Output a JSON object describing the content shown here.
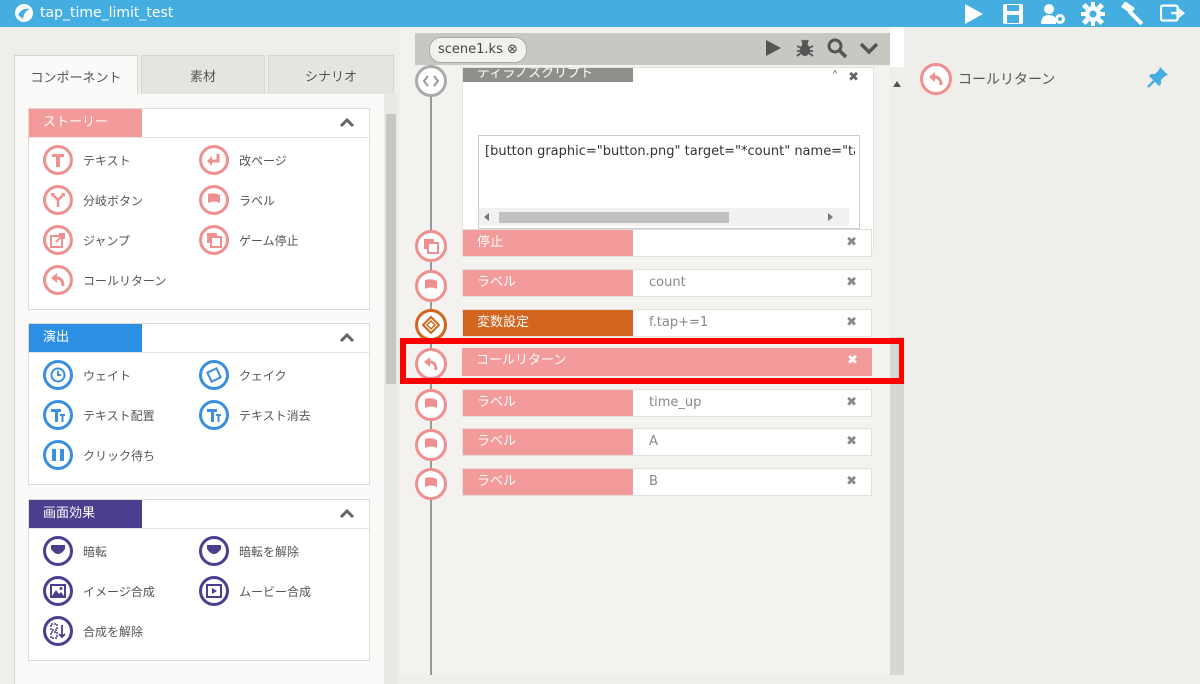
{
  "app": {
    "title": "tap_time_limit_test"
  },
  "left_tabs": [
    {
      "label": "コンポーネント",
      "active": true
    },
    {
      "label": "素材",
      "active": false
    },
    {
      "label": "シナリオ",
      "active": false
    }
  ],
  "sections": {
    "story": {
      "label": "ストーリー",
      "color": "#f39a9a",
      "items": [
        "テキスト",
        "改ページ",
        "分岐ボタン",
        "ラベル",
        "ジャンプ",
        "ゲーム停止",
        "コールリターン"
      ]
    },
    "effect": {
      "label": "演出",
      "color": "#2d8fe3",
      "items": [
        "ウェイト",
        "クェイク",
        "テキスト配置",
        "テキスト消去",
        "クリック待ち"
      ]
    },
    "screen": {
      "label": "画面効果",
      "color": "#4a3f8e",
      "items": [
        "暗転",
        "暗転を解除",
        "イメージ合成",
        "ムービー合成",
        "合成を解除"
      ]
    }
  },
  "scene": {
    "tab_label": "scene1.ks",
    "close_glyph": "⊗"
  },
  "tyrano_block": {
    "label": "ティラノスクリプト",
    "code": "[button graphic=\"button.png\" target=\"*count\" name=\"tap\" x=",
    "collapse_glyph": "˄",
    "close_glyph": "✖"
  },
  "rows": [
    {
      "name": "停止",
      "param": "",
      "close": "✖"
    },
    {
      "name": "ラベル",
      "param": "count",
      "close": "✖"
    },
    {
      "name": "変数設定",
      "param": "f.tap+=1",
      "close": "✖"
    },
    {
      "name": "コールリターン",
      "param": "",
      "close": "✖"
    },
    {
      "name": "ラベル",
      "param": "time_up",
      "close": "✖"
    },
    {
      "name": "ラベル",
      "param": "A",
      "close": "✖"
    },
    {
      "name": "ラベル",
      "param": "B",
      "close": "✖"
    }
  ],
  "right_panel": {
    "title": "コールリターン"
  },
  "colors": {
    "accent": "#45aee0",
    "highlight": "#ff0000",
    "pink": "#f39a9a",
    "orange": "#d2651f"
  }
}
